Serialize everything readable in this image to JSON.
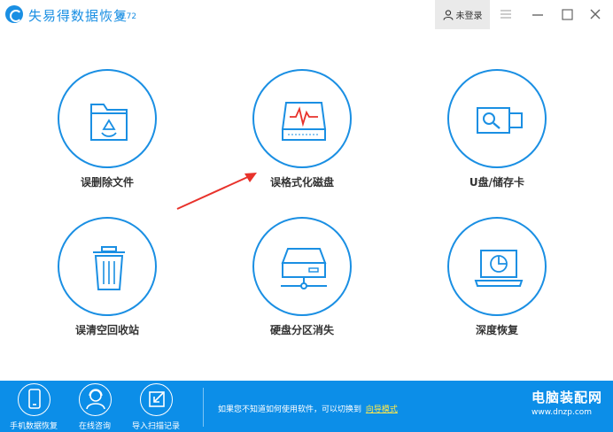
{
  "window": {
    "app_title": "失易得数据恢复",
    "version": "6.72",
    "login_label": "未登录"
  },
  "tiles": [
    {
      "label": "误删除文件",
      "icon": "folder-recycle-icon"
    },
    {
      "label": "误格式化磁盘",
      "icon": "disk-waveform-icon"
    },
    {
      "label": "U盘/储存卡",
      "icon": "usb-drive-icon"
    },
    {
      "label": "误清空回收站",
      "icon": "trash-bin-icon"
    },
    {
      "label": "硬盘分区消失",
      "icon": "hard-drive-icon"
    },
    {
      "label": "深度恢复",
      "icon": "laptop-scan-icon"
    }
  ],
  "bottom": {
    "items": [
      {
        "label": "手机数据恢复",
        "icon": "phone-icon"
      },
      {
        "label": "在线咨询",
        "icon": "support-agent-icon"
      },
      {
        "label": "导入扫描记录",
        "icon": "import-icon"
      }
    ],
    "hint_text": "如果您不知道如何使用软件，可以切换到",
    "hint_link": "向导模式",
    "watermark": "电脑装配网",
    "watermark_url": "www.dnzp.com"
  },
  "colors": {
    "accent": "#1a8fe3",
    "bottom_bar": "#0c8ee8",
    "arrow": "#e8322b",
    "link": "#ffe94a"
  }
}
